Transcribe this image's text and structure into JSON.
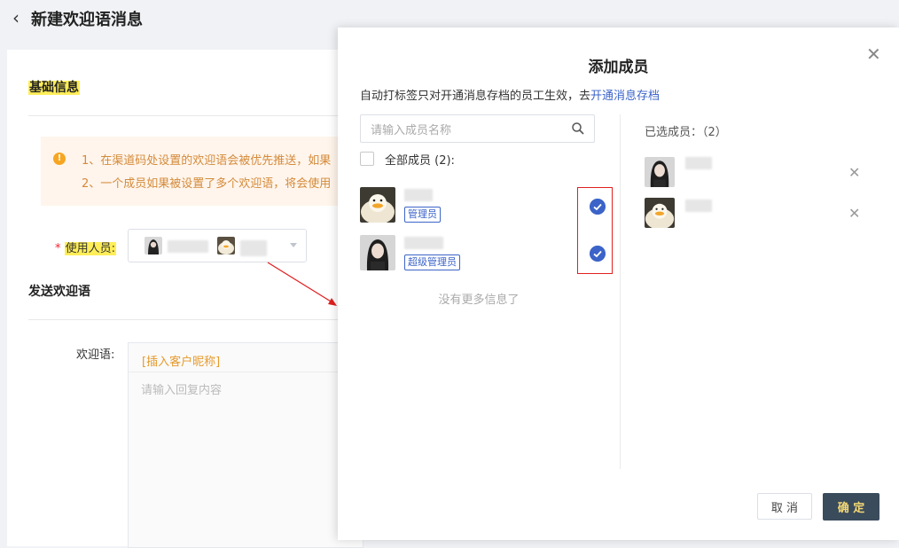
{
  "page": {
    "title": "新建欢迎语消息"
  },
  "form": {
    "basic_info_title": "基础信息",
    "notice_lines": [
      "1、在渠道码处设置的欢迎语会被优先推送，如果",
      "2、一个成员如果被设置了多个欢迎语，将会使用"
    ],
    "users_label": "使用人员:",
    "send_welcome_title": "发送欢迎语",
    "welcome_label": "欢迎语:",
    "insert_nickname": "[插入客户昵称]",
    "welcome_placeholder": "请输入回复内容"
  },
  "modal": {
    "title": "添加成员",
    "tip_text": "自动打标签只对开通消息存档的员工生效，去",
    "tip_link": "开通消息存档",
    "search_placeholder": "请输入成员名称",
    "select_all_label": "全部成员 (2):",
    "members": [
      {
        "role": "管理员",
        "avatar": "duck-avatar",
        "checked": true
      },
      {
        "role": "超级管理员",
        "avatar": "girl-avatar",
        "checked": true
      }
    ],
    "no_more": "没有更多信息了",
    "selected_header": "已选成员：（2）",
    "cancel_label": "取 消",
    "ok_label": "确 定"
  },
  "colors": {
    "accent": "#3c64c8",
    "highlight": "#ffee58",
    "notice_bg": "#fff5ec",
    "confirm_bg": "#3a4b5c",
    "annotation_red": "#e02020"
  }
}
